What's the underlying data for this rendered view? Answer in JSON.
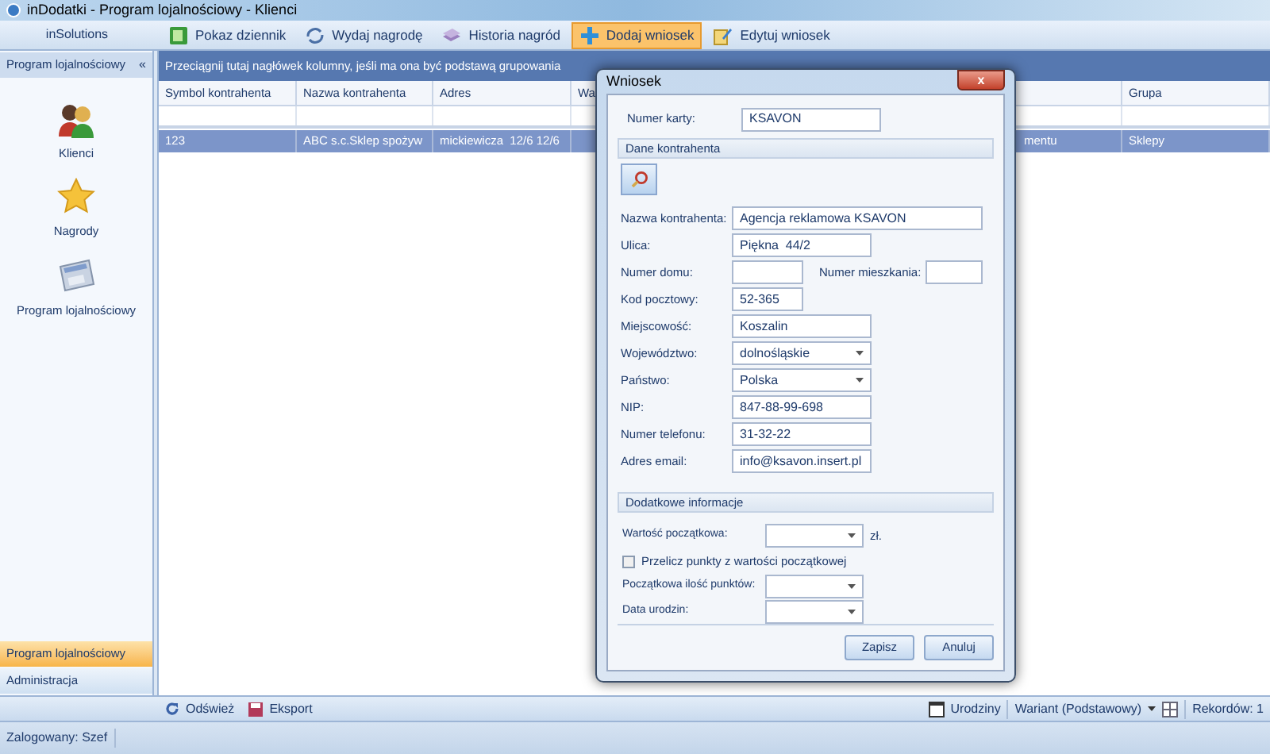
{
  "window": {
    "title": "inDodatki - Program lojalnościowy - Klienci"
  },
  "sidebar": {
    "brand": "inSolutions",
    "header": "Program lojalnościowy",
    "collapse": "«",
    "items": [
      {
        "label": "Klienci",
        "kind": "people"
      },
      {
        "label": "Nagrody",
        "kind": "star"
      },
      {
        "label": "Program lojalnościowy",
        "kind": "calculator"
      }
    ],
    "nav": [
      {
        "label": "Program lojalnościowy",
        "selected": true
      },
      {
        "label": "Administracja",
        "selected": false
      }
    ]
  },
  "toolbar": [
    {
      "label": "Pokaz dziennik",
      "kind": "log",
      "selected": false
    },
    {
      "label": "Wydaj nagrodę",
      "kind": "gift",
      "selected": false
    },
    {
      "label": "Historia nagród",
      "kind": "history",
      "selected": false
    },
    {
      "label": "Dodaj wniosek",
      "kind": "add",
      "selected": true
    },
    {
      "label": "Edytuj wniosek",
      "kind": "edit",
      "selected": false
    }
  ],
  "table": {
    "group_hint": "Przeciągnij tutaj nagłówek kolumny, jeśli ma ona być podstawą grupowania",
    "columns": [
      "Symbol kontrahenta",
      "Nazwa kontrahenta",
      "Adres",
      "Wa",
      "Grupa"
    ],
    "rows": [
      {
        "cells": [
          "123",
          "ABC s.c.Sklep spożyw",
          "mickiewicza  12/6 12/6",
          "mentu",
          "Sklepy"
        ],
        "selected": true
      }
    ]
  },
  "bottom_toolbar": {
    "left": [
      "Odśwież",
      "Eksport"
    ],
    "birthdays": "Urodziny",
    "variant": "Wariant (Podstawowy)",
    "records": "Rekordów: 1"
  },
  "status_bar": "Zalogowany: Szef",
  "dialog": {
    "title": "Wniosek",
    "close": "x",
    "card": {
      "label": "Numer karty:",
      "value": "KSAVON"
    },
    "group1": "Dane kontrahenta",
    "fields": [
      {
        "kind": "long",
        "label": "Nazwa kontrahenta:",
        "value": "Agencja reklamowa KSAVON"
      },
      {
        "kind": "medium",
        "label": "Ulica:",
        "value": "Piękna  44/2"
      },
      {
        "kind": "pair",
        "label": "Numer domu:",
        "label2": "Numer mieszkania:"
      },
      {
        "kind": "short",
        "label": "Kod pocztowy:",
        "value": "52-365"
      },
      {
        "kind": "medium",
        "label": "Miejscowość:",
        "value": "Koszalin"
      },
      {
        "kind": "combo",
        "label": "Województwo:",
        "value": "dolnośląskie"
      },
      {
        "kind": "combo",
        "label": "Państwo:",
        "value": "Polska"
      },
      {
        "kind": "medium",
        "label": "NIP:",
        "value": "847-88-99-698"
      },
      {
        "kind": "medium",
        "label": "Numer telefonu:",
        "value": "31-32-22"
      },
      {
        "kind": "medium",
        "label": "Adres email:",
        "value": "info@ksavon.insert.pl"
      }
    ],
    "group2": "Dodatkowe informacje",
    "extra": [
      {
        "kind": "combo",
        "label": "Wartość początkowa:",
        "suffix": "zł."
      },
      {
        "kind": "check",
        "label": "Przelicz punkty z wartości początkowej",
        "checked": false
      },
      {
        "kind": "combo",
        "label": "Początkowa ilość punktów:"
      },
      {
        "kind": "combo",
        "label": "Data urodzin:"
      }
    ],
    "buttons": [
      "Zapisz",
      "Anuluj"
    ]
  }
}
